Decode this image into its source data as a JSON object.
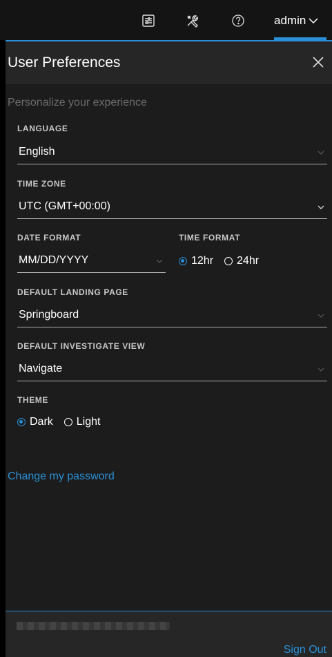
{
  "nav": {
    "icons": [
      "settings-panel-icon",
      "tools-icon",
      "help-icon"
    ],
    "user_label": "admin"
  },
  "panel": {
    "title": "User Preferences",
    "subtitle": "Personalize your experience"
  },
  "fields": {
    "language": {
      "label": "LANGUAGE",
      "value": "English"
    },
    "time_zone": {
      "label": "TIME ZONE",
      "value": "UTC (GMT+00:00)"
    },
    "date_format": {
      "label": "DATE FORMAT",
      "value": "MM/DD/YYYY"
    },
    "time_format": {
      "label": "TIME FORMAT",
      "options": [
        "12hr",
        "24hr"
      ],
      "selected": "12hr"
    },
    "landing_page": {
      "label": "DEFAULT LANDING PAGE",
      "value": "Springboard"
    },
    "investigate_view": {
      "label": "DEFAULT INVESTIGATE VIEW",
      "value": "Navigate"
    },
    "theme": {
      "label": "THEME",
      "options": [
        "Dark",
        "Light"
      ],
      "selected": "Dark"
    }
  },
  "links": {
    "change_password": "Change my password"
  },
  "footer": {
    "sign_out": "Sign Out"
  },
  "colors": {
    "accent": "#2a8fd6",
    "panel_bg": "#1c1c1c",
    "header_bg": "#262626",
    "muted_text": "#6b6b6b"
  }
}
